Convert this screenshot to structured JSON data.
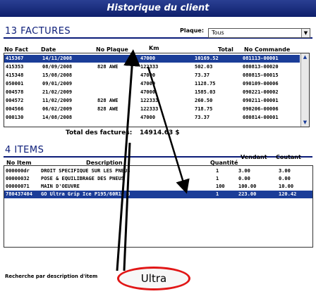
{
  "window": {
    "title": "Historique du client"
  },
  "factures": {
    "heading": "13 FACTURES",
    "plaque_label": "Plaque:",
    "plaque_value": "Tous",
    "columns": [
      "No Fact",
      "Date",
      "No Plaque",
      "Km",
      "Total",
      "No Commande"
    ],
    "rows": [
      {
        "no": "415367",
        "date": "14/11/2008",
        "plaque": "",
        "km": "47000",
        "total": "10169.52",
        "cmd": "081113-00001",
        "selected": true
      },
      {
        "no": "415353",
        "date": "08/09/2008",
        "plaque": "828 AWE",
        "km": "122333",
        "total": "502.03",
        "cmd": "080813-00020",
        "selected": false
      },
      {
        "no": "415348",
        "date": "15/08/2008",
        "plaque": "",
        "km": "47000",
        "total": "73.37",
        "cmd": "080815-00015",
        "selected": false
      },
      {
        "no": "050001",
        "date": "09/01/2009",
        "plaque": "",
        "km": "47000",
        "total": "1128.75",
        "cmd": "090109-00006",
        "selected": false
      },
      {
        "no": "004578",
        "date": "21/02/2009",
        "plaque": "",
        "km": "47000",
        "total": "1585.03",
        "cmd": "090221-00002",
        "selected": false
      },
      {
        "no": "004572",
        "date": "11/02/2009",
        "plaque": "828 AWE",
        "km": "122333",
        "total": "260.50",
        "cmd": "090211-00001",
        "selected": false
      },
      {
        "no": "004566",
        "date": "06/02/2009",
        "plaque": "828 AWE",
        "km": "122333",
        "total": "718.75",
        "cmd": "090206-00006",
        "selected": false
      },
      {
        "no": "000130",
        "date": "14/08/2008",
        "plaque": "",
        "km": "47000",
        "total": "73.37",
        "cmd": "080814-00001",
        "selected": false
      }
    ],
    "total_label": "Total des factures:",
    "total_value": "14914.63 $"
  },
  "items": {
    "heading": "4 ITEMS",
    "columns": [
      "No Item",
      "Description",
      "Quantité",
      "Vendant",
      "Coutant"
    ],
    "rows": [
      {
        "no": "000000dr",
        "desc": "DROIT SPECIFIQUE SUR LES PNEUS",
        "qty": "1",
        "vendant": "3.00",
        "coutant": "3.00",
        "selected": false
      },
      {
        "no": "00000032",
        "desc": "POSE & EQUILIBRAGE DES PNEUS",
        "qty": "1",
        "vendant": "0.00",
        "coutant": "0.00",
        "selected": false
      },
      {
        "no": "00000071",
        "desc": "MAIN D'OEUVRE",
        "qty": "100",
        "vendant": "100.00",
        "coutant": "10.00",
        "selected": false
      },
      {
        "no": "780437404",
        "desc": "GO Ultra Grip Ice P195/60R15 8",
        "qty": "1",
        "vendant": "223.00",
        "coutant": "120.42",
        "selected": true
      }
    ]
  },
  "search": {
    "label": "Recherche par description d'item",
    "value": "Ultra"
  },
  "colors": {
    "title_bar": "#0e1f6b",
    "selection": "#1b3d98",
    "highlight_ring": "#e11616"
  }
}
